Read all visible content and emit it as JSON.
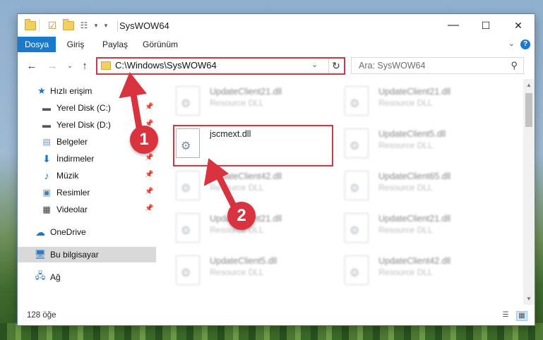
{
  "window": {
    "title": "SysWOW64",
    "controls": {
      "minimize": "—",
      "maximize": "☐",
      "close": "✕"
    }
  },
  "ribbon": {
    "tabs": [
      "Dosya",
      "Giriş",
      "Paylaş",
      "Görünüm"
    ],
    "help_icon": "question-icon"
  },
  "address": {
    "path": "C:\\Windows\\SysWOW64",
    "search_placeholder": "Ara: SysWOW64"
  },
  "nav": {
    "quick_access": "Hızlı erişim",
    "items": [
      {
        "label": "Yerel Disk (C:)",
        "icon": "drive-icon",
        "pinned": true
      },
      {
        "label": "Yerel Disk (D:)",
        "icon": "drive-icon",
        "pinned": true
      },
      {
        "label": "Belgeler",
        "icon": "documents-icon",
        "pinned": true
      },
      {
        "label": "İndirmeler",
        "icon": "download-icon",
        "pinned": true
      },
      {
        "label": "Müzik",
        "icon": "music-icon",
        "pinned": true
      },
      {
        "label": "Resimler",
        "icon": "pictures-icon",
        "pinned": true
      },
      {
        "label": "Videolar",
        "icon": "videos-icon",
        "pinned": true
      }
    ],
    "onedrive": "OneDrive",
    "this_pc": "Bu bilgisayar",
    "network": "Ağ"
  },
  "files": {
    "highlighted": {
      "name": "jscmext.dll",
      "desc": ""
    },
    "left_column": [
      {
        "name": "UpdateClient21.dll",
        "desc": "Resource DLL"
      },
      {
        "name": "UpdateClient42.dll",
        "desc": "Resource DLL"
      },
      {
        "name": "UpdateClient21.dll",
        "desc": "Resource DLL"
      },
      {
        "name": "UpdateClient5.dll",
        "desc": "Resource DLL"
      }
    ],
    "right_column": [
      {
        "name": "UpdateClient21.dll",
        "desc": "Resource DLL"
      },
      {
        "name": "UpdateClient5.dll",
        "desc": "Resource DLL"
      },
      {
        "name": "UpdateClient65.dll",
        "desc": "Resource DLL"
      },
      {
        "name": "UpdateClient21.dll",
        "desc": "Resource DLL"
      },
      {
        "name": "UpdateClient42.dll",
        "desc": "Resource DLL"
      }
    ]
  },
  "status": {
    "count": "128 öğe"
  },
  "annotations": {
    "step1": "1",
    "step2": "2",
    "color": "#d9333f"
  }
}
